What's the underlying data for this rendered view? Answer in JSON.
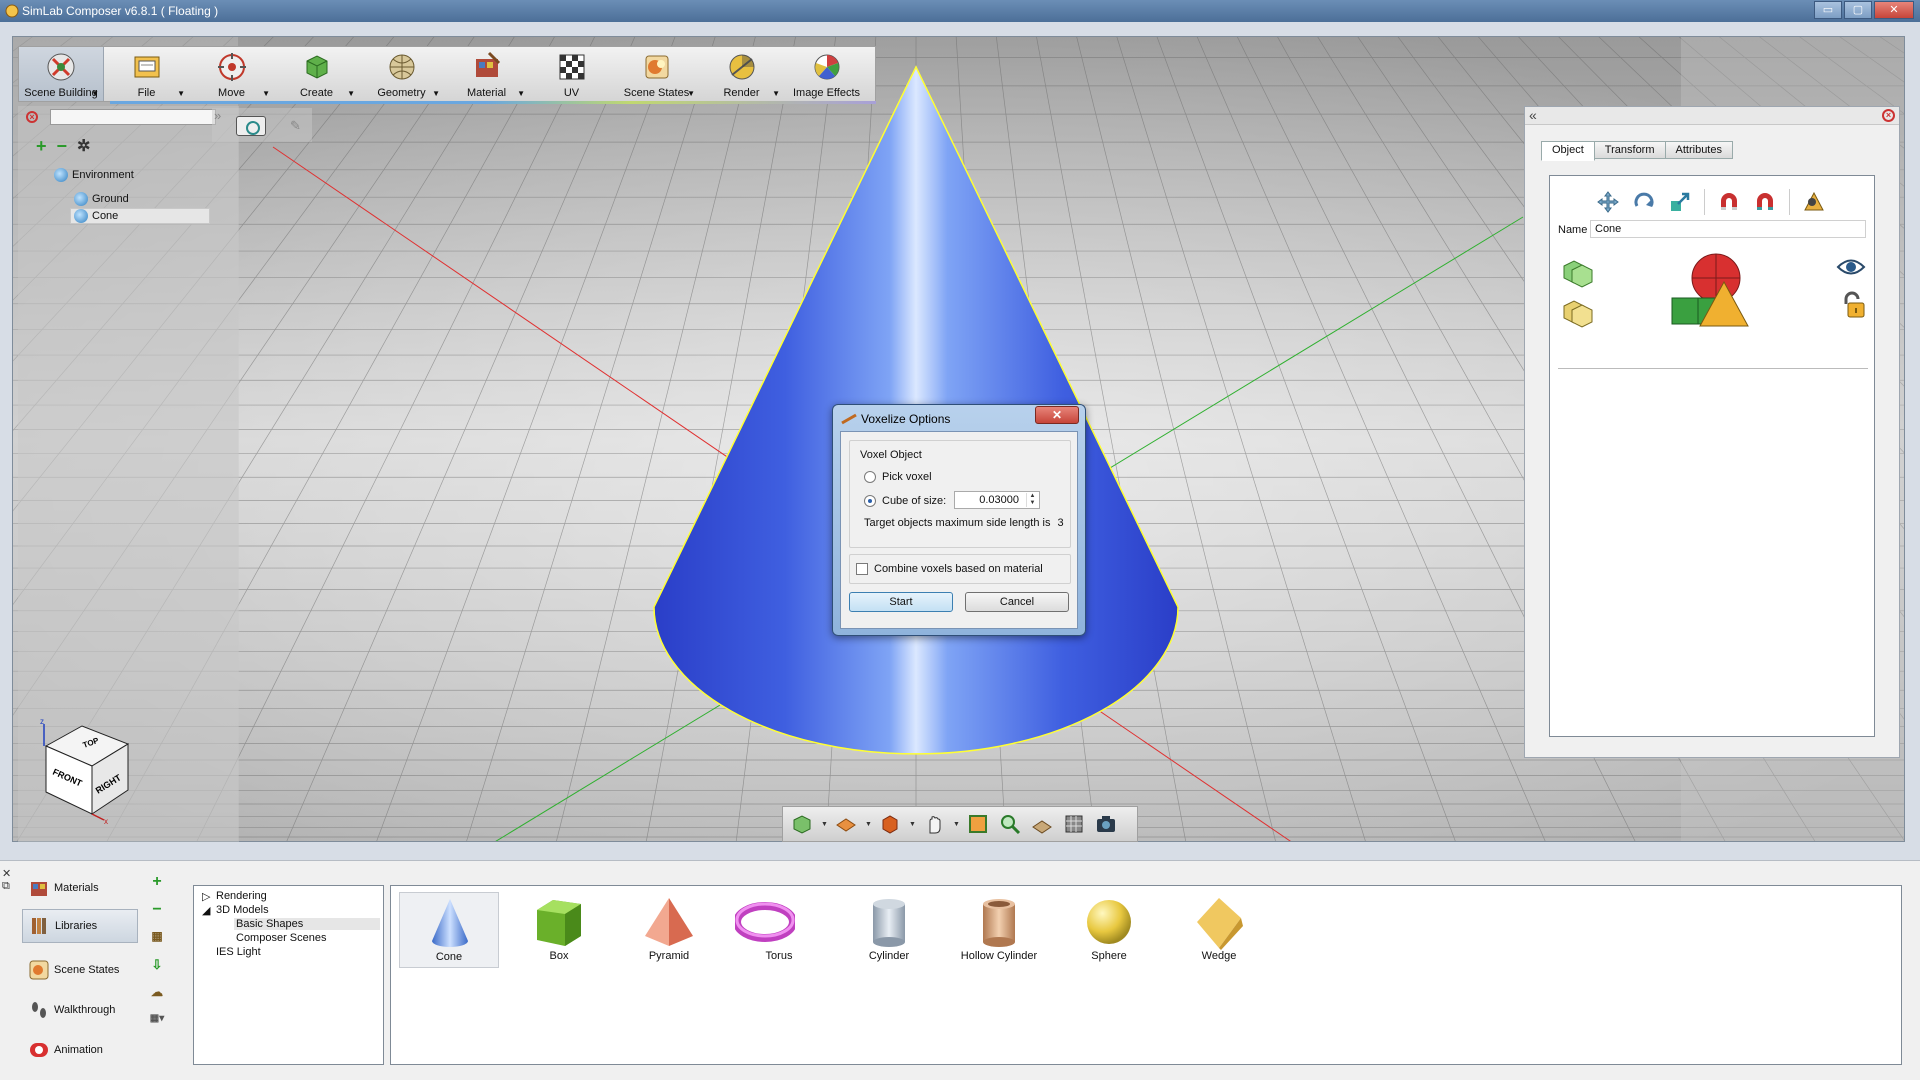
{
  "window": {
    "title": "SimLab Composer v6.8.1 ( Floating )",
    "controls": [
      "▭",
      "▢",
      "✕"
    ]
  },
  "toolbar": {
    "items": [
      {
        "label": "Scene Building",
        "icon": "scene-building-icon",
        "has_menu": true
      },
      {
        "label": "File",
        "icon": "file-icon",
        "has_menu": true
      },
      {
        "label": "Move",
        "icon": "move-icon",
        "has_menu": true
      },
      {
        "label": "Create",
        "icon": "create-icon",
        "has_menu": true
      },
      {
        "label": "Geometry",
        "icon": "geometry-icon",
        "has_menu": true
      },
      {
        "label": "Material",
        "icon": "material-icon",
        "has_menu": true
      },
      {
        "label": "UV",
        "icon": "uv-icon",
        "has_menu": false
      },
      {
        "label": "Scene States",
        "icon": "scene-states-icon",
        "has_menu": true
      },
      {
        "label": "Render",
        "icon": "render-icon",
        "has_menu": true
      },
      {
        "label": "Image Effects",
        "icon": "image-effects-icon",
        "has_menu": false
      }
    ]
  },
  "scene_tree": {
    "root": "Environment",
    "children": [
      "Ground",
      "Cone"
    ],
    "selected": "Cone"
  },
  "viewcube": {
    "top": "TOP",
    "front": "FRONT",
    "right": "RIGHT",
    "axes": [
      "z",
      "x"
    ]
  },
  "properties": {
    "tabs": [
      "Object",
      "Transform",
      "Attributes"
    ],
    "active_tab": "Object",
    "name_label": "Name",
    "name_value": "Cone"
  },
  "dialog": {
    "title": "Voxelize Options",
    "close": "✕",
    "group_title": "Voxel Object",
    "option_pick": "Pick voxel",
    "option_cube": "Cube of size:",
    "cube_size": "0.03000",
    "target_info_label": "Target objects maximum side length is",
    "target_info_value": "3",
    "combine_label": "Combine voxels based on material",
    "start_label": "Start",
    "cancel_label": "Cancel"
  },
  "bottom_nav": {
    "items": [
      "Materials",
      "Libraries",
      "Scene States",
      "Walkthrough",
      "Animation"
    ],
    "active": "Libraries"
  },
  "library_tree": {
    "rendering": "Rendering",
    "models": "3D Models",
    "basic_shapes": "Basic Shapes",
    "composer_scenes": "Composer Scenes",
    "ies_light": "IES Light",
    "expand_collapsed": "▷",
    "expand_open": "◢"
  },
  "library_items": [
    "Cone",
    "Box",
    "Pyramid",
    "Torus",
    "Cylinder",
    "Hollow Cylinder",
    "Sphere",
    "Wedge"
  ],
  "colors": {
    "cone_blue": "#3f5fe0",
    "selection_outline": "#ffff33",
    "axis_red": "#e03030",
    "axis_green": "#30b030"
  }
}
